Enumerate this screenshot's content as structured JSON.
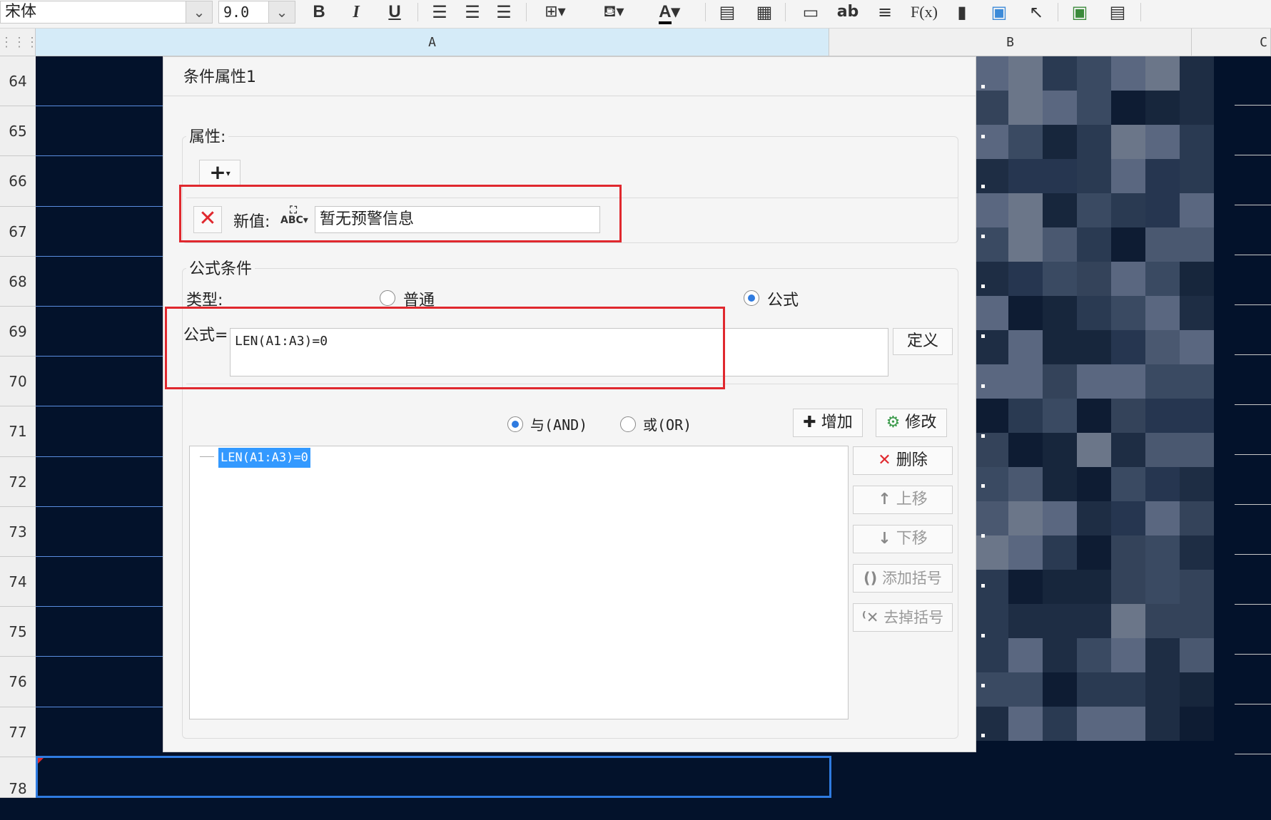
{
  "toolbar": {
    "font_name": "宋体",
    "font_size": "9.0",
    "bold_label": "B",
    "italic_label": "I",
    "underline_label": "U",
    "wrap_label": "ab",
    "formula_label": "F(x)",
    "icons": [
      "bold-icon",
      "italic-icon",
      "underline-icon",
      "align-left-icon",
      "align-center-icon",
      "align-right-icon",
      "border-icon",
      "fill-color-icon",
      "font-color-icon",
      "insert-row-icon",
      "grid-icon",
      "merge-icon",
      "wrap-text-icon",
      "paragraph-icon",
      "formula-icon",
      "chart-icon",
      "image-icon",
      "pointer-icon",
      "style-icon",
      "list-icon"
    ]
  },
  "columns": {
    "a": "A",
    "b": "B",
    "c": "C"
  },
  "rows": [
    "64",
    "65",
    "66",
    "67",
    "68",
    "69",
    "70",
    "71",
    "72",
    "73",
    "74",
    "75",
    "76",
    "77",
    "78"
  ],
  "dialog": {
    "title": "条件属性1",
    "attributes_legend": "属性:",
    "add_label": "+",
    "new_value_label": "新值:",
    "new_value": "暂无预警信息",
    "formula_condition_legend": "公式条件",
    "type_label": "类型:",
    "type_normal": "普通",
    "type_formula": "公式",
    "type_selected": "公式",
    "formula_label": "公式=",
    "formula_value": "LEN(A1:A3)=0",
    "define_button": "定义",
    "and_label": "与(AND)",
    "or_label": "或(OR)",
    "logic_selected": "与(AND)",
    "add_button": "增加",
    "modify_button": "修改",
    "condition_items": [
      "LEN(A1:A3)=0"
    ],
    "delete_button": "删除",
    "move_up_button": "上移",
    "move_down_button": "下移",
    "add_bracket_button": "添加括号",
    "remove_bracket_button": "去掉括号"
  },
  "colors": {
    "sheet_bg": "#03122b",
    "highlight": "#e0282e",
    "accent": "#2f7be0",
    "selection": "#3399ff"
  }
}
